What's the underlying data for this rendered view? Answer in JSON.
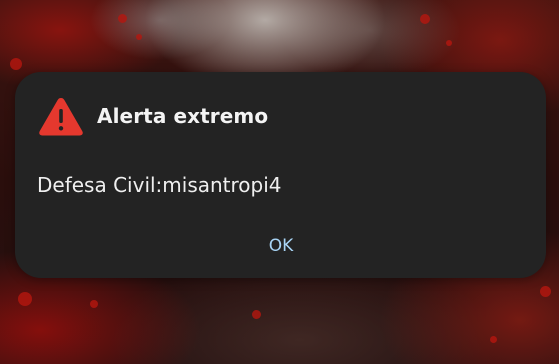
{
  "alert": {
    "title": "Alerta extremo",
    "message": "Defesa Civil:misantropi4",
    "ok_label": "OK",
    "icon": "warning-triangle-icon"
  },
  "colors": {
    "dialog_background": "#232323",
    "icon_red": "#e5382e",
    "ok_text": "#a8d4f5",
    "text": "#efefef"
  }
}
